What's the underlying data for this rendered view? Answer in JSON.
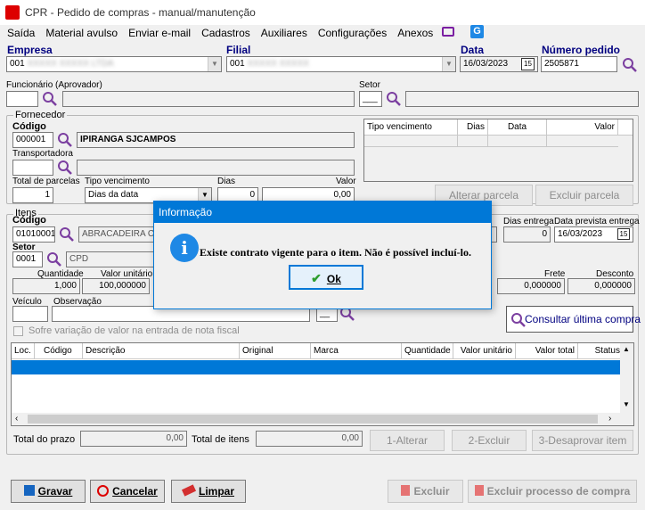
{
  "window": {
    "title": "CPR - Pedido de compras - manual/manutenção"
  },
  "menu": [
    "Saída",
    "Material avulso",
    "Enviar e-mail",
    "Cadastros",
    "Auxiliares",
    "Configurações",
    "Anexos"
  ],
  "header": {
    "empresa_label": "Empresa",
    "empresa_value": "001",
    "filial_label": "Filial",
    "filial_value": "001",
    "data_label": "Data",
    "data_value": "16/03/2023",
    "pedido_label": "Número pedido",
    "pedido_value": "2505871",
    "funcionario_label": "Funcionário (Aprovador)",
    "setor_label": "Setor",
    "setor_value": "___"
  },
  "fornecedor": {
    "group_label": "Fornecedor",
    "codigo_label": "Código",
    "codigo_value": "000001",
    "nome_value": "IPIRANGA SJCAMPOS",
    "transportadora_label": "Transportadora",
    "parcelas_label": "Total de parcelas",
    "parcelas_value": "1",
    "tipo_venc_label": "Tipo vencimento",
    "tipo_venc_value": "Dias da data",
    "dias_label": "Dias",
    "dias_value": "0",
    "valor_label": "Valor",
    "valor_value": "0,00",
    "grid_headers": [
      "Tipo vencimento",
      "Dias",
      "Data",
      "Valor"
    ],
    "alterar_parcela": "Alterar parcela",
    "excluir_parcela": "Excluir parcela"
  },
  "itens": {
    "group_label": "Itens",
    "codigo_label": "Código",
    "codigo_value": "01010001",
    "descricao_value": "ABRACADEIRA C",
    "dias_entrega_label": "Dias entrega",
    "dias_entrega_value": "0",
    "data_prevista_label": "Data prevista entrega",
    "data_prevista_value": "16/03/2023",
    "setor_label": "Setor",
    "setor_value": "0001",
    "setor_nome": "CPD",
    "quantidade_label": "Quantidade",
    "quantidade_value": "1,000",
    "valor_unit_label": "Valor unitário",
    "valor_unit_value": "100,000000",
    "frete_label": "Frete",
    "frete_value": "0,000000",
    "desconto_label": "Desconto",
    "desconto_value": "0,000000",
    "veiculo_label": "Veículo",
    "observacao_label": "Observação",
    "consultar_label": "Consultar última compra",
    "sofre_label": "Sofre variação de valor na entrada de nota fiscal",
    "grid_headers": [
      "Loc.",
      "Código",
      "Descrição",
      "Original",
      "Marca",
      "Quantidade",
      "Valor unitário",
      "Valor total",
      "Status"
    ],
    "total_prazo_label": "Total do prazo",
    "total_prazo_value": "0,00",
    "total_itens_label": "Total de itens",
    "total_itens_value": "0,00",
    "alterar_btn": "1-Alterar",
    "excluir_btn": "2-Excluir",
    "desaprovar_btn": "3-Desaprovar item"
  },
  "footer": {
    "gravar": "Gravar",
    "cancelar": "Cancelar",
    "limpar": "Limpar",
    "excluir": "Excluir",
    "excluir_processo": "Excluir processo de compra"
  },
  "dialog": {
    "title": "Informação",
    "message": "Existe contrato vigente para o item. Não é possível incluí-lo.",
    "ok": "Ok",
    "icon": "info-icon"
  },
  "colors": {
    "accent": "#0078d7",
    "selected_row": "#0078d7",
    "label_blue": "#000080"
  }
}
